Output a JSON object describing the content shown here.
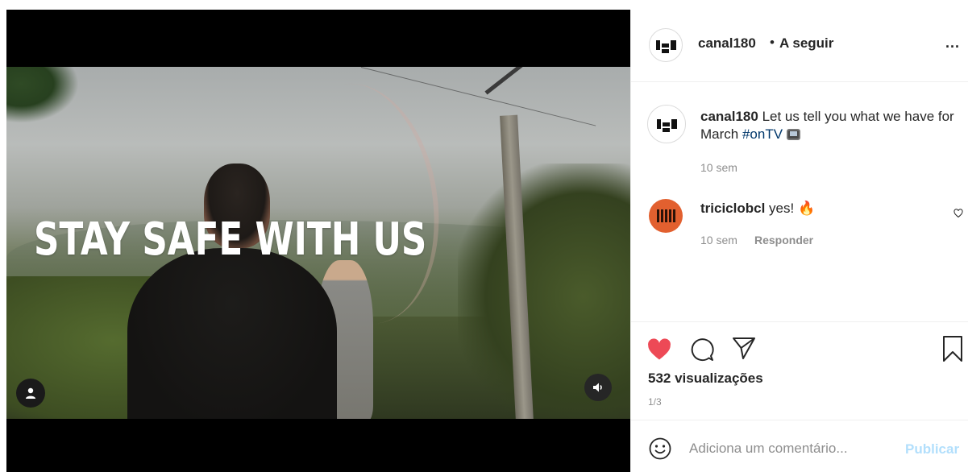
{
  "post": {
    "author": "canal180",
    "separator": "•",
    "follow_label": "A seguir",
    "more_label": "...",
    "caption_author": "canal180",
    "caption_text": "Let us tell you what we have for March",
    "caption_hashtag": "#onTV",
    "caption_time": "10 sem",
    "video_overlay_text": "STAY SAFE WITH US"
  },
  "comments": [
    {
      "author": "triciclobcl",
      "text": "yes! 🔥",
      "time": "10 sem",
      "reply_label": "Responder"
    }
  ],
  "actions": {
    "views_text": "532 visualizações",
    "pager_text": "1/3",
    "liked": true
  },
  "composer": {
    "placeholder": "Adiciona um comentário...",
    "publish_label": "Publicar"
  },
  "icons": {
    "user_tag": "user-icon",
    "sound": "speaker-icon",
    "like": "heart-icon",
    "comment": "comment-icon",
    "share": "paper-plane-icon",
    "save": "bookmark-icon",
    "emoji": "smiley-icon"
  },
  "colors": {
    "like_red": "#ed4956",
    "hashtag_blue": "#00376b",
    "publish_disabled": "#b2dffc",
    "avatar_orange": "#e2602f"
  }
}
